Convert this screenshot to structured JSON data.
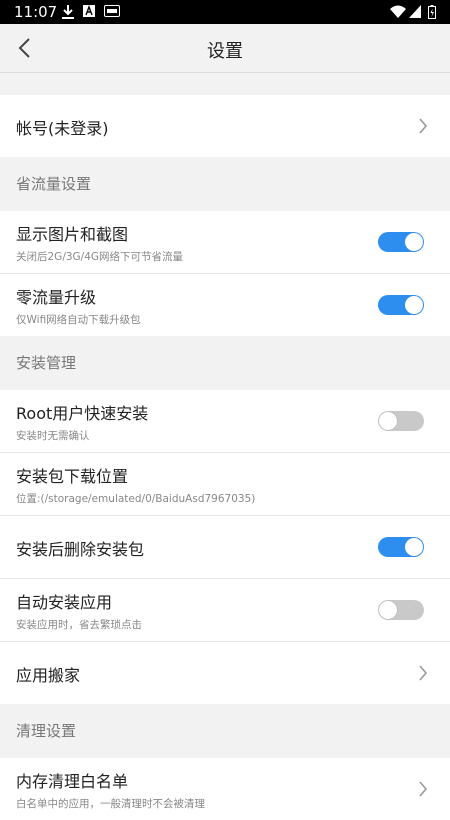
{
  "status_bar": {
    "time": "11:07",
    "icons": [
      "download-icon",
      "a-icon",
      "notification-badge-icon",
      "wifi-icon",
      "signal-icon",
      "battery-icon"
    ]
  },
  "header": {
    "back_icon": "chevron-left-icon",
    "title": "设置"
  },
  "account": {
    "label": "帐号(未登录)"
  },
  "sections": {
    "data_saving": {
      "title": "省流量设置"
    },
    "install": {
      "title": "安装管理"
    },
    "cleanup": {
      "title": "清理设置"
    }
  },
  "items": {
    "show_images": {
      "title": "显示图片和截图",
      "subtitle": "关闭后2G/3G/4G网络下可节省流量",
      "enabled": true
    },
    "zero_traffic_upgrade": {
      "title": "零流量升级",
      "subtitle": "仅Wifi网络自动下载升级包",
      "enabled": true
    },
    "root_quick_install": {
      "title": "Root用户快速安装",
      "subtitle": "安装时无需确认",
      "enabled": false
    },
    "download_location": {
      "title": "安装包下载位置",
      "subtitle": "位置:(/storage/emulated/0/BaiduAsd7967035)"
    },
    "delete_after_install": {
      "title": "安装后删除安装包",
      "enabled": true
    },
    "auto_install": {
      "title": "自动安装应用",
      "subtitle": "安装应用时，省去繁琐点击",
      "enabled": false
    },
    "app_mover": {
      "title": "应用搬家"
    },
    "memory_whitelist": {
      "title": "内存清理白名单",
      "subtitle": "白名单中的应用，一般清理时不会被清理"
    }
  },
  "colors": {
    "accent": "#2e8ef0",
    "toggle_off": "#c9c9c9",
    "background": "#f2f2f2"
  }
}
